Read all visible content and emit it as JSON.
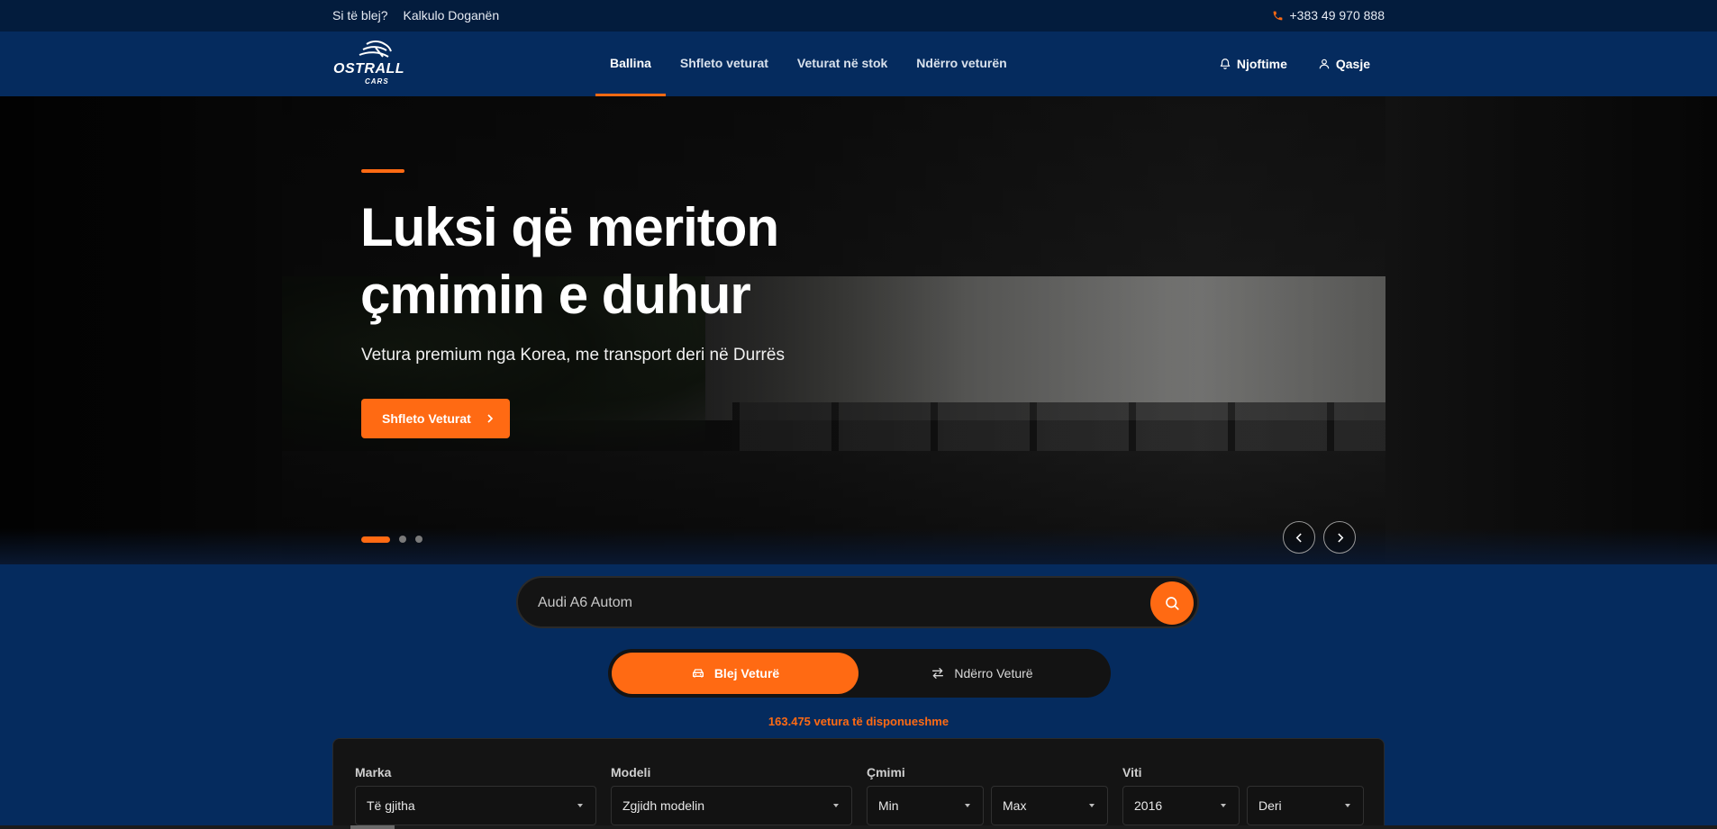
{
  "topbar": {
    "links": [
      "Si të blej?",
      "Kalkulo Doganën"
    ],
    "phone": "+383 49 970 888"
  },
  "logo": {
    "brand": "OSTRALL",
    "sub": "CARS"
  },
  "nav": {
    "items": [
      "Ballina",
      "Shfleto veturat",
      "Veturat në stok",
      "Ndërro veturën"
    ],
    "active": "Ballina",
    "notifications": "Njoftime",
    "login": "Qasje"
  },
  "hero": {
    "title_line1": "Luksi që meriton",
    "title_line2": "çmimin e duhur",
    "subtitle": "Vetura premium nga Korea, me transport deri në Durrës",
    "cta": "Shfleto Veturat",
    "slides_total": 3,
    "active_slide": 1
  },
  "search": {
    "value": "Audi A6 Autom"
  },
  "toggle": {
    "buy": "Blej Veturë",
    "swap": "Ndërro Veturë"
  },
  "available": "163.475 vetura të disponueshme",
  "filters": {
    "brand_label": "Marka",
    "brand_value": "Të gjitha",
    "model_label": "Modeli",
    "model_value": "Zgjidh modelin",
    "price_label": "Çmimi",
    "price_min": "Min",
    "price_max": "Max",
    "year_label": "Viti",
    "year_from": "2016",
    "year_to": "Deri"
  },
  "colors": {
    "accent": "#ff6a13",
    "navy": "#052b5e",
    "topbar": "#031c3d"
  }
}
